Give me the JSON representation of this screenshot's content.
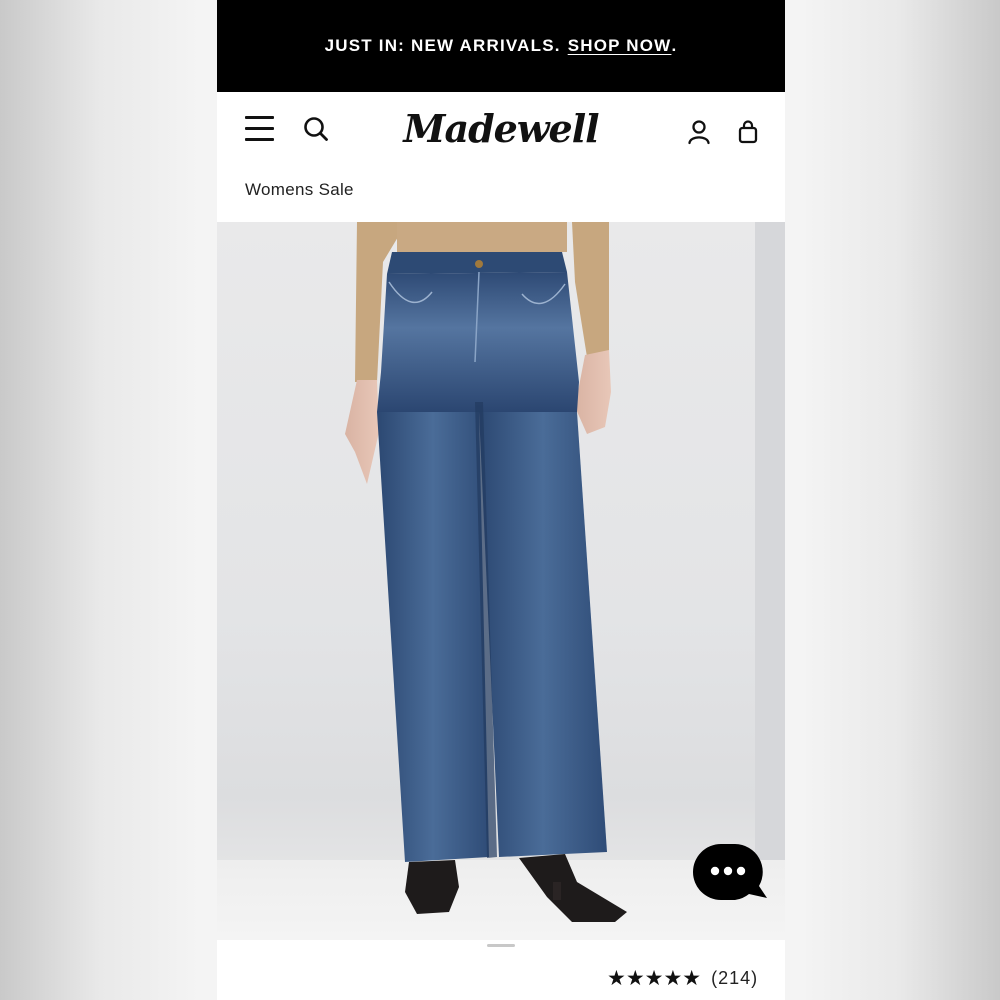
{
  "promo": {
    "text": "JUST IN: NEW ARRIVALS.",
    "link": "SHOP NOW",
    "suffix": "."
  },
  "header": {
    "logo": "Madewell",
    "breadcrumb": "Womens Sale",
    "icons": [
      "menu-icon",
      "search-icon",
      "account-icon",
      "bag-icon"
    ]
  },
  "product": {
    "image_alt": "model wearing wide-leg medium-wash jeans with black boots",
    "rating": {
      "stars": "★★★★★",
      "value": 4.5,
      "count": "(214)"
    }
  },
  "chat": {
    "icon": "chat-icon"
  },
  "colors": {
    "promo_bg": "#000000",
    "denim": "#3b5b86",
    "text": "#111111"
  }
}
